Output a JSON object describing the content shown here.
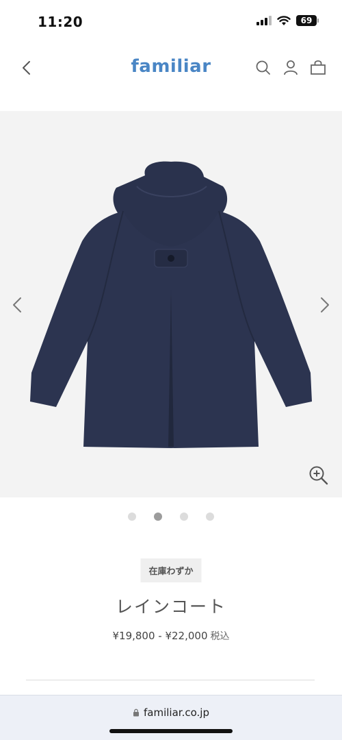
{
  "status_bar": {
    "time": "11:20",
    "battery": "69",
    "signal_icon": "signal-icon",
    "wifi_icon": "wifi-icon"
  },
  "header": {
    "brand": "familiar",
    "back_icon": "chevron-left-icon",
    "search_icon": "search-icon",
    "account_icon": "user-icon",
    "cart_icon": "bag-icon"
  },
  "gallery": {
    "current_slide": 2,
    "total_slides": 4,
    "prev_icon": "chevron-left-icon",
    "next_icon": "chevron-right-icon",
    "zoom_icon": "zoom-in-icon"
  },
  "product": {
    "stock_badge": "在庫わずか",
    "title": "レインコート",
    "price": "¥19,800 - ¥22,000",
    "tax_label": "税込"
  },
  "browser": {
    "url": "familiar.co.jp",
    "lock_icon": "lock-icon"
  },
  "colors": {
    "brand": "#4a86c5",
    "coat": "#2c3450",
    "gallery_bg": "#f3f3f3"
  }
}
